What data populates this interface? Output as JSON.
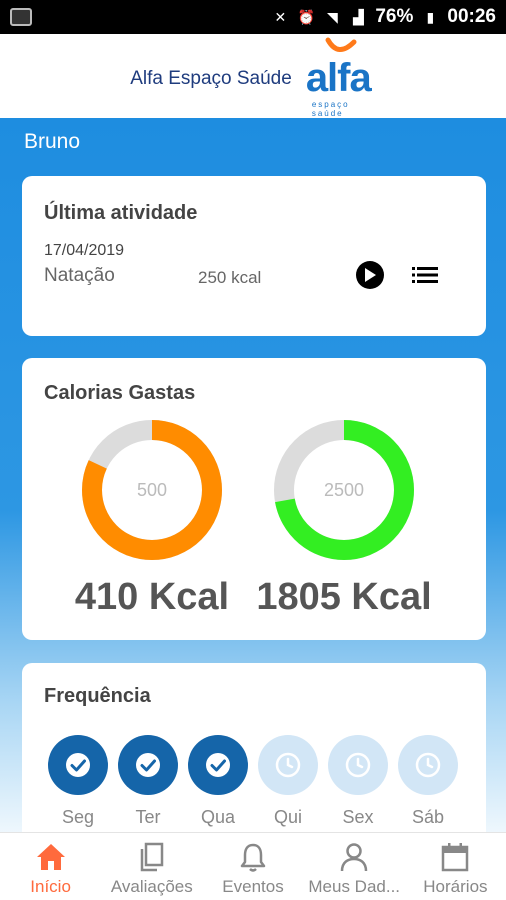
{
  "status_bar": {
    "battery": "76%",
    "time": "00:26"
  },
  "header": {
    "brand_name": "Alfa Espaço Saúde",
    "logo_word": "alfa",
    "logo_sub": "espaço saúde"
  },
  "user": {
    "name": "Bruno"
  },
  "last_activity": {
    "title": "Última atividade",
    "date": "17/04/2019",
    "activity": "Natação",
    "kcal": "250 kcal"
  },
  "calories": {
    "title": "Calorias Gastas",
    "gauges": [
      {
        "goal": "500",
        "value_label": "410 Kcal",
        "fraction": 0.82,
        "color": "#ff8c00",
        "track": "#dcdcdc"
      },
      {
        "goal": "2500",
        "value_label": "1805 Kcal",
        "fraction": 0.722,
        "color": "#33ee22",
        "track": "#dcdcdc"
      }
    ]
  },
  "frequency": {
    "title": "Frequência",
    "days": [
      {
        "label": "Seg",
        "done": true
      },
      {
        "label": "Ter",
        "done": true
      },
      {
        "label": "Qua",
        "done": true
      },
      {
        "label": "Qui",
        "done": false
      },
      {
        "label": "Sex",
        "done": false
      },
      {
        "label": "Sáb",
        "done": false
      }
    ]
  },
  "nav": {
    "items": [
      {
        "label": "Início",
        "icon": "home-icon",
        "active": true
      },
      {
        "label": "Avaliações",
        "icon": "documents-icon",
        "active": false
      },
      {
        "label": "Eventos",
        "icon": "bell-icon",
        "active": false
      },
      {
        "label": "Meus Dad...",
        "icon": "user-icon",
        "active": false
      },
      {
        "label": "Horários",
        "icon": "calendar-icon",
        "active": false
      }
    ]
  },
  "colors": {
    "primary": "#1e8de0",
    "accent": "#ff6a3d",
    "day_done": "#1565a9",
    "day_pending": "#d2e6f6"
  }
}
